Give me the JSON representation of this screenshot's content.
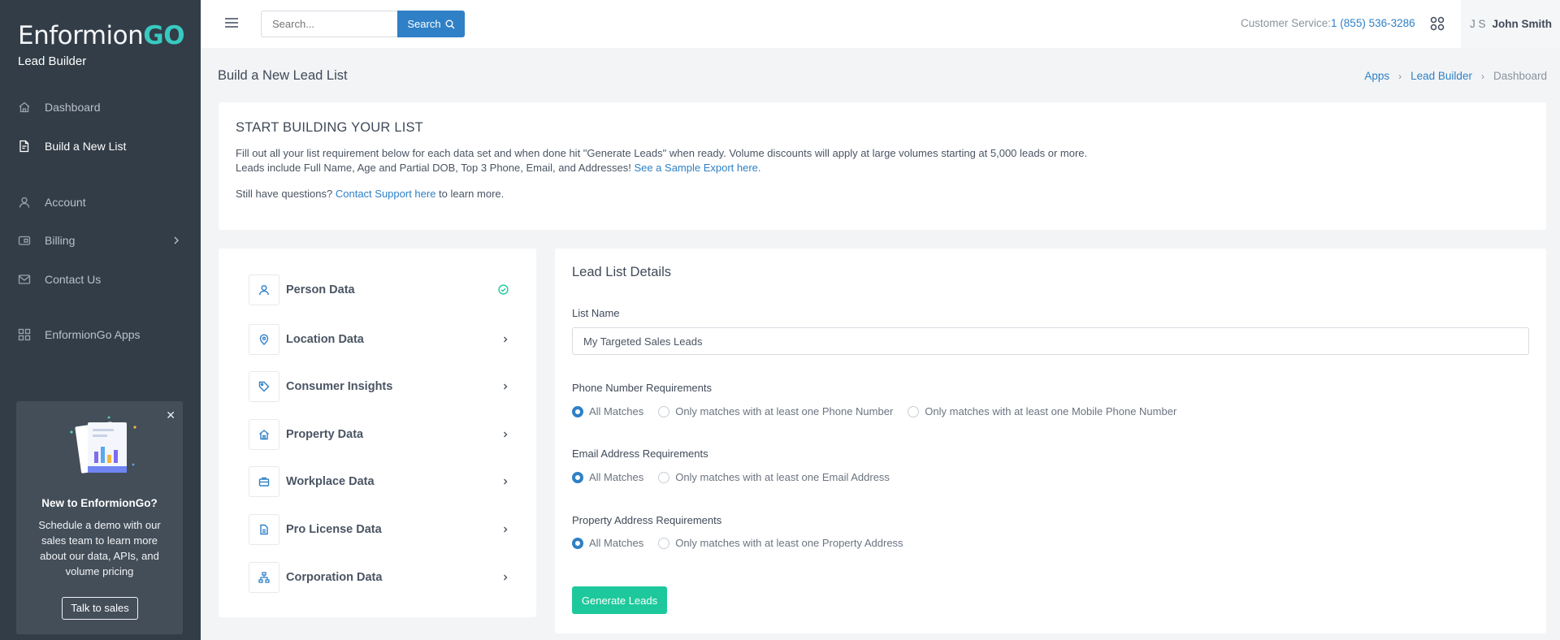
{
  "brand": {
    "name_main": "Enformion",
    "name_accent": "GO",
    "product": "Lead Builder"
  },
  "sidebar": {
    "items": [
      {
        "label": "Dashboard",
        "icon": "home-icon"
      },
      {
        "label": "Build a New List",
        "icon": "document-icon"
      },
      {
        "label": "Account",
        "icon": "user-icon"
      },
      {
        "label": "Billing",
        "icon": "wallet-icon"
      },
      {
        "label": "Contact Us",
        "icon": "mail-icon"
      },
      {
        "label": "EnformionGo Apps",
        "icon": "grid-icon"
      }
    ],
    "promo": {
      "title": "New to EnformionGo?",
      "text": "Schedule a demo with our sales team to learn more about our data, APIs, and volume pricing",
      "button": "Talk to sales"
    }
  },
  "topbar": {
    "search_placeholder": "Search...",
    "search_button": "Search",
    "customer_service_label": "Customer Service:",
    "customer_service_phone": "1 (855) 536-3286",
    "user_initials": "J S",
    "user_name": "John Smith"
  },
  "page": {
    "title": "Build a New Lead List",
    "breadcrumbs": [
      "Apps",
      "Lead Builder",
      "Dashboard"
    ]
  },
  "intro": {
    "heading": "START BUILDING YOUR LIST",
    "line1": "Fill out all your list requirement below for each data set and when done hit \"Generate Leads\" when ready. Volume discounts will apply at large volumes starting at 5,000 leads or more.",
    "line2_text": "Leads include Full Name, Age and Partial DOB, Top 3 Phone, Email, and Addresses! ",
    "line2_link": "See a Sample Export here.",
    "line3_pre": "Still have questions? ",
    "line3_link": "Contact Support here",
    "line3_post": " to learn more."
  },
  "data_sets": [
    {
      "label": "Person Data",
      "icon": "person-icon",
      "status": "complete"
    },
    {
      "label": "Location Data",
      "icon": "location-pin-icon",
      "status": "open"
    },
    {
      "label": "Consumer Insights",
      "icon": "tag-icon",
      "status": "open"
    },
    {
      "label": "Property Data",
      "icon": "house-icon",
      "status": "open"
    },
    {
      "label": "Workplace Data",
      "icon": "briefcase-icon",
      "status": "open"
    },
    {
      "label": "Pro License Data",
      "icon": "file-icon",
      "status": "open"
    },
    {
      "label": "Corporation Data",
      "icon": "org-chart-icon",
      "status": "open"
    }
  ],
  "form": {
    "title": "Lead List Details",
    "list_name_label": "List Name",
    "list_name_value": "My Targeted Sales Leads",
    "phone": {
      "label": "Phone Number Requirements",
      "options": [
        "All Matches",
        "Only matches with at least one Phone Number",
        "Only matches with at least one Mobile Phone Number"
      ],
      "selected": 0
    },
    "email": {
      "label": "Email Address Requirements",
      "options": [
        "All Matches",
        "Only matches with at least one Email Address"
      ],
      "selected": 0
    },
    "address": {
      "label": "Property Address Requirements",
      "options": [
        "All Matches",
        "Only matches with at least one Property Address"
      ],
      "selected": 0
    },
    "submit": "Generate Leads"
  },
  "colors": {
    "sidebar": "#323d47",
    "accent": "#2f80c6",
    "brand_go": "#38c9c0",
    "success": "#1dc99c"
  }
}
